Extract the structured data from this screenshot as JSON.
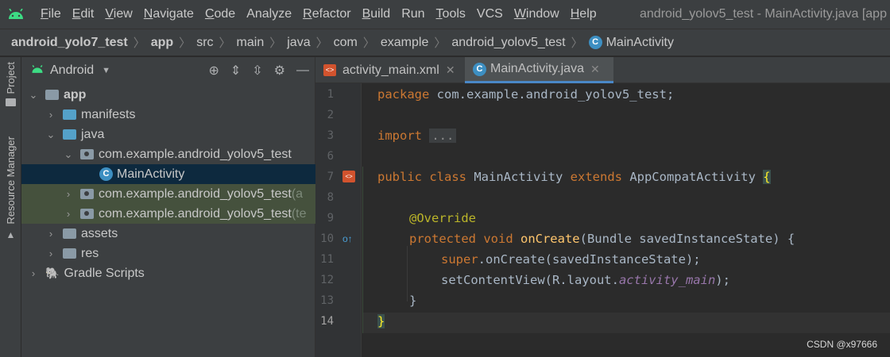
{
  "menu": {
    "items": [
      {
        "label": "File",
        "mnemonic": "F",
        "rest": "ile"
      },
      {
        "label": "Edit",
        "mnemonic": "E",
        "rest": "dit"
      },
      {
        "label": "View",
        "mnemonic": "V",
        "rest": "iew"
      },
      {
        "label": "Navigate",
        "mnemonic": "N",
        "rest": "avigate"
      },
      {
        "label": "Code",
        "mnemonic": "C",
        "rest": "ode"
      },
      {
        "label": "Analyze",
        "mnemonic": "",
        "rest": "Analyze"
      },
      {
        "label": "Refactor",
        "mnemonic": "R",
        "rest": "efactor"
      },
      {
        "label": "Build",
        "mnemonic": "B",
        "rest": "uild"
      },
      {
        "label": "Run",
        "mnemonic": "",
        "rest": "Run"
      },
      {
        "label": "Tools",
        "mnemonic": "T",
        "rest": "ools"
      },
      {
        "label": "VCS",
        "mnemonic": "",
        "rest": "VCS"
      },
      {
        "label": "Window",
        "mnemonic": "W",
        "rest": "indow"
      },
      {
        "label": "Help",
        "mnemonic": "H",
        "rest": "elp"
      }
    ],
    "window_title": "android_yolov5_test - MainActivity.java [app"
  },
  "breadcrumb": {
    "items": [
      "android_yolo7_test",
      "app",
      "src",
      "main",
      "java",
      "com",
      "example",
      "android_yolov5_test",
      "MainActivity"
    ]
  },
  "toolstrip": {
    "project_label": "Project",
    "resource_label": "Resource Manager"
  },
  "project_panel": {
    "view_label": "Android",
    "tree": [
      {
        "label": "app",
        "suffix": ""
      },
      {
        "label": "manifests",
        "suffix": ""
      },
      {
        "label": "java",
        "suffix": ""
      },
      {
        "label": "com.example.android_yolov5_test",
        "suffix": ""
      },
      {
        "label": "MainActivity",
        "suffix": ""
      },
      {
        "label": "com.example.android_yolov5_test",
        "suffix": " (a"
      },
      {
        "label": "com.example.android_yolov5_test",
        "suffix": " (te"
      },
      {
        "label": "assets",
        "suffix": ""
      },
      {
        "label": "res",
        "suffix": ""
      },
      {
        "label": "Gradle Scripts",
        "suffix": ""
      }
    ]
  },
  "editor": {
    "tabs": [
      {
        "label": "activity_main.xml",
        "active": false
      },
      {
        "label": "MainActivity.java",
        "active": true
      }
    ],
    "line_numbers": [
      "1",
      "2",
      "3",
      "6",
      "7",
      "8",
      "9",
      "10",
      "11",
      "12",
      "13",
      "14"
    ],
    "code": {
      "l1_kw": "package ",
      "l1_rest": "com.example.android_yolov5_test;",
      "l3_kw": "import ",
      "l3_fold": "...",
      "l7_kw1": "public class ",
      "l7_name": "MainActivity ",
      "l7_kw2": "extends ",
      "l7_super": "AppCompatActivity ",
      "l7_brace": "{",
      "l9_anno": "@Override",
      "l10_kw": "protected void ",
      "l10_fn": "onCreate",
      "l10_rest": "(Bundle savedInstanceState) {",
      "l11_kw": "super",
      "l11_rest": ".onCreate(savedInstanceState);",
      "l12_a": "setContentView(R.layout.",
      "l12_it": "activity_main",
      "l12_b": ");",
      "l13": "}",
      "l14_brace": "}"
    }
  },
  "watermark": "CSDN @x97666",
  "colors": {
    "accent": "#4a88c7",
    "keyword": "#cc7832",
    "function": "#ffc66d",
    "annotation": "#bbb529",
    "field_italic": "#9876aa",
    "android_green": "#3ddc84"
  }
}
